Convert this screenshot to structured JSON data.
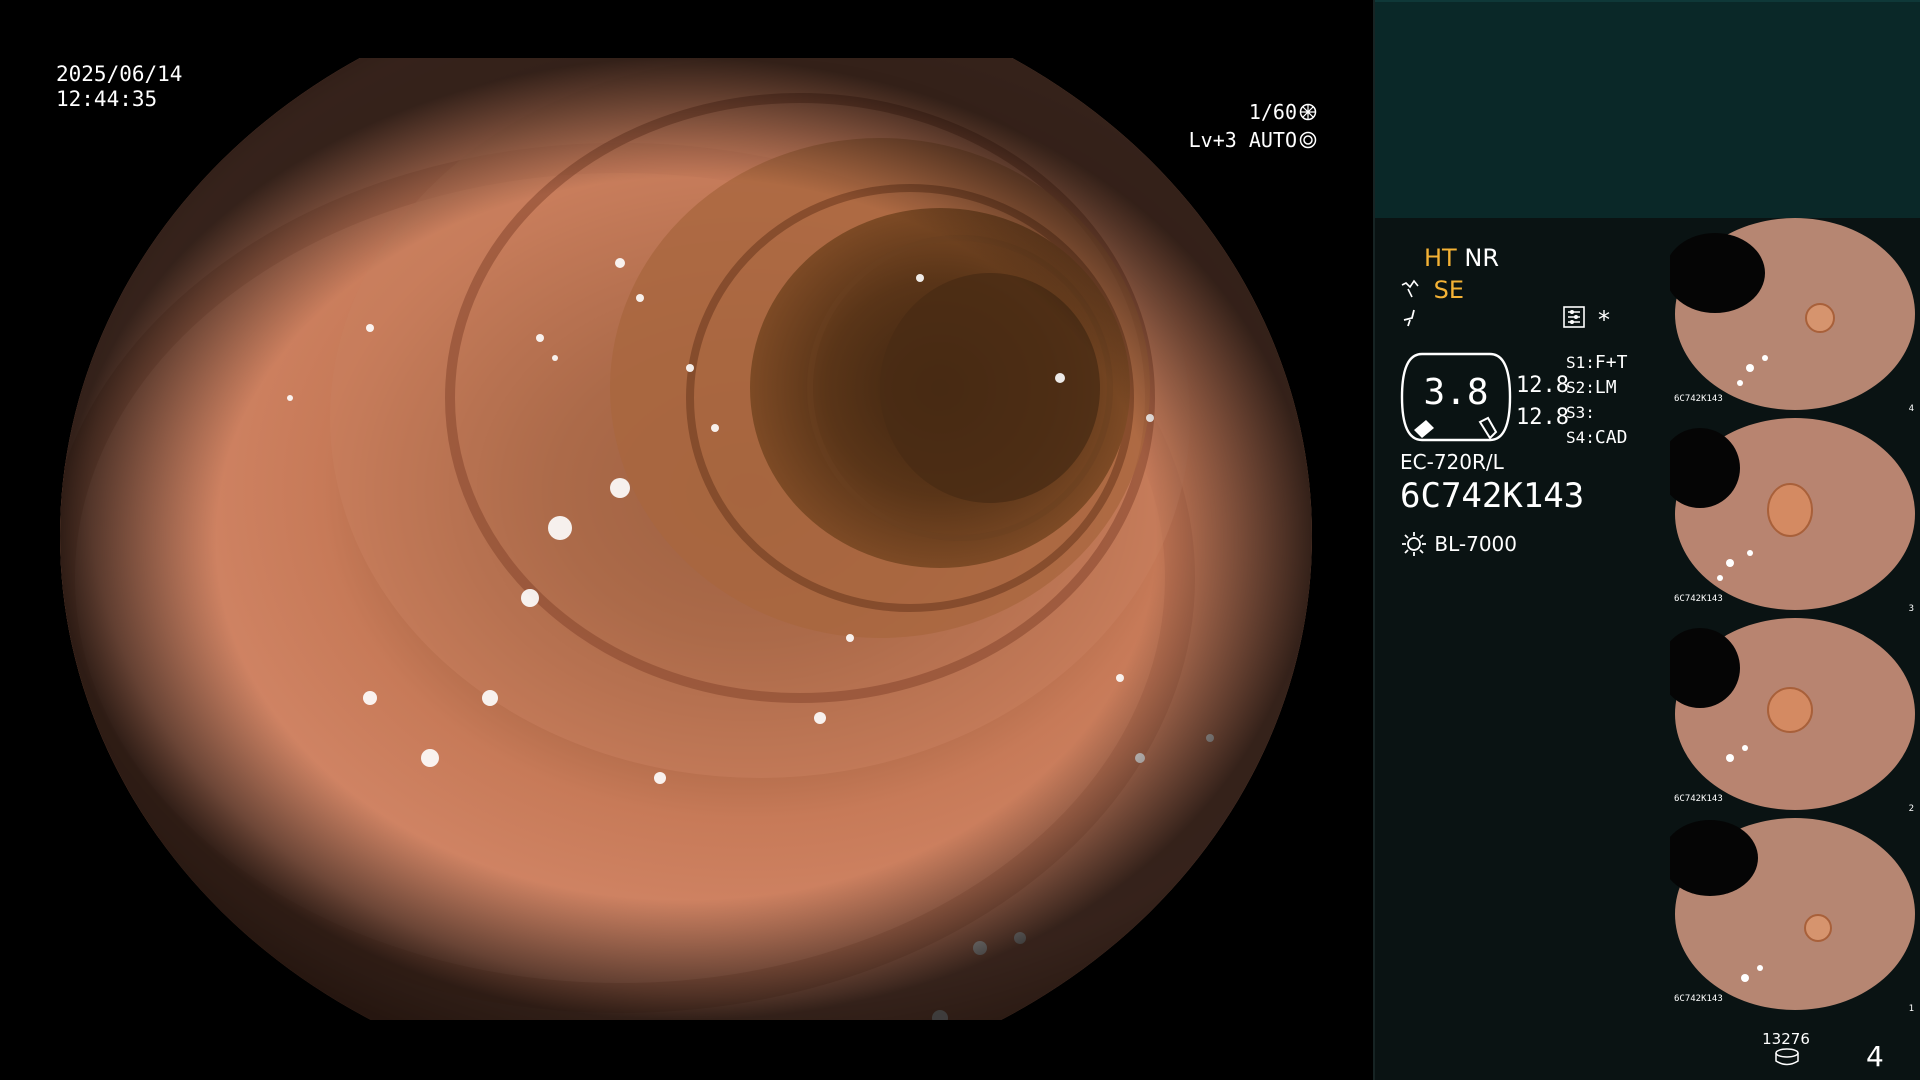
{
  "overlay": {
    "date": "2025/06/14",
    "time": "12:44:35",
    "shutter": "1/60",
    "level": "Lv+3",
    "mode": "AUTO"
  },
  "panel": {
    "ht": "HT",
    "nr": "NR",
    "se": "SE",
    "asterisk": "*",
    "gauge_value": "3.8",
    "val1": "12.8",
    "val2": "12.8",
    "s1_label": "S1:",
    "s1_value": "F+T",
    "s2_label": "S2:",
    "s2_value": "LM",
    "s3_label": "S3:",
    "s3_value": "",
    "s4_label": "S4:",
    "s4_value": "CAD",
    "scope_model": "EC-720R/L",
    "scope_serial": "6C742K143",
    "light_source": "BL-7000",
    "storage_count": "13276",
    "image_count": "4"
  },
  "thumbnails": [
    {
      "serial": "6C742K143",
      "index": "4"
    },
    {
      "serial": "6C742K143",
      "index": "3"
    },
    {
      "serial": "6C742K143",
      "index": "2"
    },
    {
      "serial": "6C742K143",
      "index": "1"
    }
  ],
  "colors": {
    "panel_top": "#0a2828",
    "panel": "#0a1313",
    "accent_orange": "#f4b235"
  },
  "icons": [
    "shutter-icon",
    "auto-iris-icon",
    "enhance-icon",
    "flash-icon",
    "settings-icon",
    "light-source-icon",
    "storage-icon"
  ]
}
